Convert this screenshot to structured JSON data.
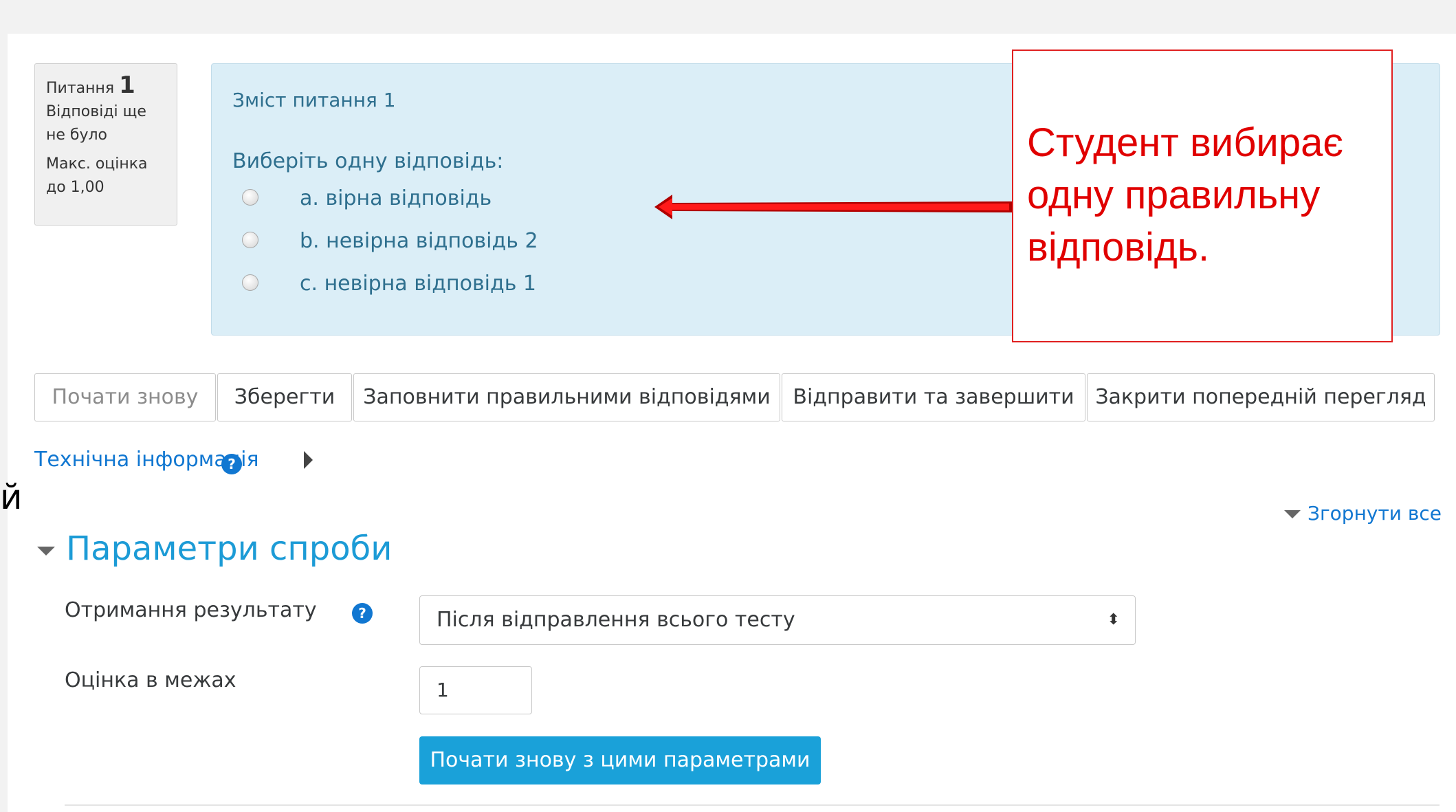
{
  "question_info": {
    "label": "Питання",
    "number": "1",
    "status": "Відповіді ще не було",
    "max_grade": "Макс. оцінка до 1,00"
  },
  "question": {
    "title": "Зміст питання 1",
    "prompt": "Виберіть одну відповідь:",
    "options": [
      {
        "text": "a. вірна відповідь",
        "selected": false
      },
      {
        "text": "b. невірна відповідь 2",
        "selected": false
      },
      {
        "text": "c. невірна відповідь 1",
        "selected": false
      }
    ]
  },
  "callout": {
    "lines": [
      "Студент вибирає",
      "одну правильну",
      "відповідь."
    ],
    "color": "#e00000"
  },
  "buttons": {
    "restart": "Почати знову",
    "save": "Зберегти",
    "fill_correct": "Заповнити правильними відповідями",
    "submit_finish": "Відправити та завершити",
    "close_preview": "Закрити попередній перегляд"
  },
  "tech_info": {
    "label": "Технічна інформація",
    "help_icon": "?"
  },
  "edge_text": "й",
  "collapse_all": "Згорнути все",
  "attempt_options": {
    "title": "Параметри спроби",
    "result_label": "Отримання результату",
    "result_help_icon": "?",
    "result_value": "Після відправлення всього тесту",
    "select_arrows": "⬍",
    "grade_label": "Оцінка в межах",
    "grade_value": "1",
    "restart_button": "Почати знову з цими параметрами"
  },
  "colors": {
    "accent": "#1177d1",
    "primary_button": "#1aa1d9",
    "question_bg": "#dbeef7",
    "callout_border": "#e02020",
    "arrow": "#e00000"
  }
}
